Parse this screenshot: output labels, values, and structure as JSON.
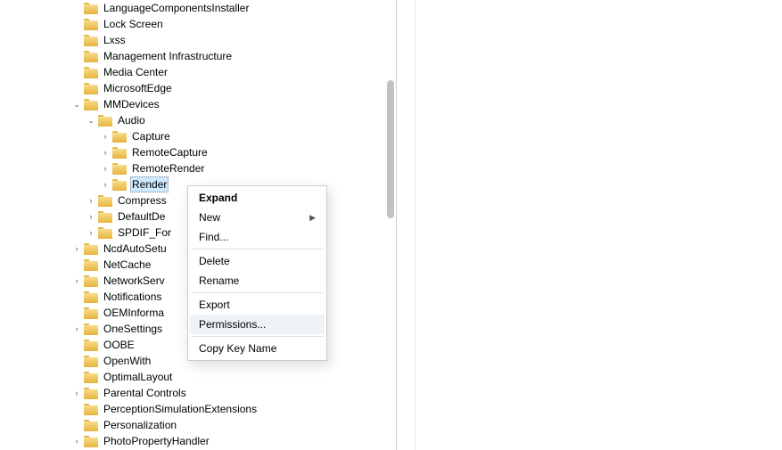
{
  "tree": {
    "items": [
      {
        "depth": 0,
        "expander": "none",
        "label": "LanguageComponentsInstaller"
      },
      {
        "depth": 0,
        "expander": "none",
        "label": "Lock Screen"
      },
      {
        "depth": 0,
        "expander": "none",
        "label": "Lxss"
      },
      {
        "depth": 0,
        "expander": "none",
        "label": "Management Infrastructure"
      },
      {
        "depth": 0,
        "expander": "none",
        "label": "Media Center"
      },
      {
        "depth": 0,
        "expander": "none",
        "label": "MicrosoftEdge"
      },
      {
        "depth": 0,
        "expander": "open",
        "label": "MMDevices"
      },
      {
        "depth": 1,
        "expander": "open",
        "label": "Audio"
      },
      {
        "depth": 2,
        "expander": "closed",
        "label": "Capture"
      },
      {
        "depth": 2,
        "expander": "closed",
        "label": "RemoteCapture"
      },
      {
        "depth": 2,
        "expander": "closed",
        "label": "RemoteRender"
      },
      {
        "depth": 2,
        "expander": "closed",
        "label": "Render",
        "selected": true
      },
      {
        "depth": 1,
        "expander": "closed",
        "label": "Compress"
      },
      {
        "depth": 1,
        "expander": "closed",
        "label": "DefaultDe"
      },
      {
        "depth": 1,
        "expander": "closed",
        "label": "SPDIF_For"
      },
      {
        "depth": 0,
        "expander": "closed",
        "label": "NcdAutoSetu"
      },
      {
        "depth": 0,
        "expander": "none",
        "label": "NetCache"
      },
      {
        "depth": 0,
        "expander": "closed",
        "label": "NetworkServ"
      },
      {
        "depth": 0,
        "expander": "none",
        "label": "Notifications"
      },
      {
        "depth": 0,
        "expander": "none",
        "label": "OEMInforma"
      },
      {
        "depth": 0,
        "expander": "closed",
        "label": "OneSettings"
      },
      {
        "depth": 0,
        "expander": "none",
        "label": "OOBE"
      },
      {
        "depth": 0,
        "expander": "none",
        "label": "OpenWith"
      },
      {
        "depth": 0,
        "expander": "none",
        "label": "OptimalLayout"
      },
      {
        "depth": 0,
        "expander": "closed",
        "label": "Parental Controls"
      },
      {
        "depth": 0,
        "expander": "none",
        "label": "PerceptionSimulationExtensions"
      },
      {
        "depth": 0,
        "expander": "none",
        "label": "Personalization"
      },
      {
        "depth": 0,
        "expander": "closed",
        "label": "PhotoPropertyHandler"
      }
    ]
  },
  "menu": {
    "items": [
      {
        "label": "Expand",
        "bold": true
      },
      {
        "label": "New",
        "submenu": true
      },
      {
        "label": "Find..."
      },
      {
        "sep": true
      },
      {
        "label": "Delete"
      },
      {
        "label": "Rename"
      },
      {
        "sep": true
      },
      {
        "label": "Export"
      },
      {
        "label": "Permissions...",
        "hover": true
      },
      {
        "sep": true
      },
      {
        "label": "Copy Key Name"
      }
    ]
  }
}
